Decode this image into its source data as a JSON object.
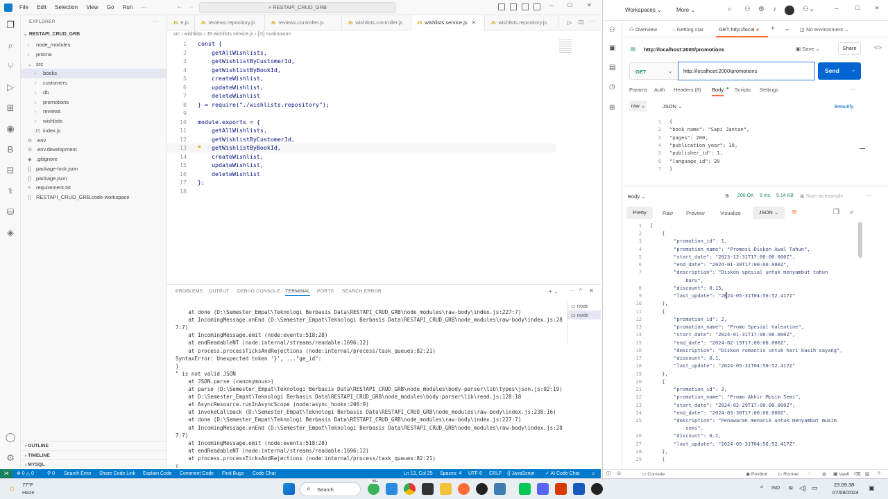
{
  "vscode": {
    "menu": [
      "File",
      "Edit",
      "Selection",
      "View",
      "Go",
      "Run"
    ],
    "menu_more": "···",
    "search_box": "RESTAPI_CRUD_GRB",
    "explorer_title": "EXPLORER",
    "explorer_more": "···",
    "root": "RESTAPI_CRUD_GRB",
    "tree": [
      {
        "label": "node_modules",
        "indent": 1,
        "arrow": "›"
      },
      {
        "label": "prisma",
        "indent": 1,
        "arrow": "›"
      },
      {
        "label": "src",
        "indent": 1,
        "arrow": "⌄"
      },
      {
        "label": "books",
        "indent": 2,
        "arrow": "›",
        "selected": true
      },
      {
        "label": "customers",
        "indent": 2,
        "arrow": "›"
      },
      {
        "label": "db",
        "indent": 2,
        "arrow": "›"
      },
      {
        "label": "promotions",
        "indent": 2,
        "arrow": "›"
      },
      {
        "label": "reviews",
        "indent": 2,
        "arrow": "›"
      },
      {
        "label": "wishlists",
        "indent": 2,
        "arrow": "›"
      },
      {
        "label": "index.js",
        "indent": 2,
        "arrow": "JS"
      },
      {
        "label": ".env",
        "indent": 1,
        "arrow": "⚙"
      },
      {
        "label": ".env.development",
        "indent": 1,
        "arrow": "⚙"
      },
      {
        "label": ".gitignore",
        "indent": 1,
        "arrow": "◆"
      },
      {
        "label": "package-lock.json",
        "indent": 1,
        "arrow": "{}"
      },
      {
        "label": "package.json",
        "indent": 1,
        "arrow": "{}"
      },
      {
        "label": "requirement.txt",
        "indent": 1,
        "arrow": "≡"
      },
      {
        "label": "RESTAPI_CRUD_GRB.code-workspace",
        "indent": 1,
        "arrow": "{}"
      }
    ],
    "sidebar_bottom": [
      "OUTLINE",
      "TIMELINE",
      "MYSQL"
    ],
    "tabs": [
      {
        "label": "e.js",
        "active": false
      },
      {
        "label": "reviews.repository.js",
        "active": false
      },
      {
        "label": "reviews.controller.js",
        "active": false
      },
      {
        "label": "wishlists.controller.js",
        "active": false
      },
      {
        "label": "wishlists.service.js",
        "active": true
      },
      {
        "label": "wishlists.repository.js",
        "active": false
      }
    ],
    "breadcrumb": "src › wishlists › JS wishlists.service.js › [∅] <unknown>",
    "code": [
      "const {",
      "    getAllWishlists,",
      "    getWishlistByCustomerId,",
      "    getWishlistByBookId,",
      "    createWishlist,",
      "    updateWishlist,",
      "    deleteWishlist",
      "} = require(\"./wishlists.repository\");",
      "",
      "module.exports = {",
      "    getAllWishlists,",
      "    getWishlistByCustomerId,",
      "    getWishlistByBookId,",
      "    createWishlist,",
      "    updateWishlist,",
      "    deleteWishlist",
      "};",
      ""
    ],
    "panel_tabs": [
      "PROBLEMS",
      "OUTPUT",
      "DEBUG CONSOLE",
      "TERMINAL",
      "PORTS",
      "SEARCH ERROR"
    ],
    "terminal": [
      "    at done (D:\\Semester_Empat\\Teknologi Berbasis Data\\RESTAPI_CRUD_GRB\\node_modules\\raw-body\\index.js:227:7)",
      "    at IncomingMessage.onEnd (D:\\Semester_Empat\\Teknologi Berbasis Data\\RESTAPI_CRUD_GRB\\node_modules\\raw-body\\index.js:28",
      "7:7)",
      "    at IncomingMessage.emit (node:events:518:28)",
      "    at endReadableNT (node:internal/streams/readable:1696:12)",
      "    at process.processTicksAndRejections (node:internal/process/task_queues:82:21)",
      "SyntaxError: Unexpected token '}', ...\"ge_id\":",
      "}",
      "\" is not valid JSON",
      "    at JSON.parse (<anonymous>)",
      "    at parse (D:\\Semester_Empat\\Teknologi Berbasis Data\\RESTAPI_CRUD_GRB\\node_modules\\body-parser\\lib\\types\\json.js:92:19)",
      "    at D:\\Semester_Empat\\Teknologi Berbasis Data\\RESTAPI_CRUD_GRB\\node_modules\\body-parser\\lib\\read.js:128:18",
      "    at AsyncResource.runInAsyncScope (node:async_hooks:206:9)",
      "    at invokeCallback (D:\\Semester_Empat\\Teknologi Berbasis Data\\RESTAPI_CRUD_GRB\\node_modules\\raw-body\\index.js:238:16)",
      "    at done (D:\\Semester_Empat\\Teknologi Berbasis Data\\RESTAPI_CRUD_GRB\\node_modules\\raw-body\\index.js:227:7)",
      "    at IncomingMessage.onEnd (D:\\Semester_Empat\\Teknologi Berbasis Data\\RESTAPI_CRUD_GRB\\node_modules\\raw-body\\index.js:28",
      "7:7)",
      "    at IncomingMessage.emit (node:events:518:28)",
      "    at endReadableNT (node:internal/streams/readable:1696:12)",
      "    at process.processTicksAndRejections (node:internal/process/task_queues:82:21)",
      "▯"
    ],
    "terminal_instances": [
      "node",
      "node"
    ],
    "status": {
      "errors": "⊗ 0 △ 0",
      "ports": "⚲ 0",
      "items": [
        "Search Error",
        "Share Code Link",
        "Explain Code",
        "Comment Code",
        "Find Bugs",
        "Code Chat"
      ],
      "position": "Ln 13, Col 25",
      "spaces": "Spaces: 4",
      "encoding": "UTF-8",
      "eol": "CRLF",
      "language": "{} JavaScript",
      "ai": "✓ AI Code Chat"
    }
  },
  "postman": {
    "workspaces": "Workspaces",
    "more": "More",
    "tabs": [
      "Overview",
      "Getting star",
      "GET http://local"
    ],
    "no_env": "No environment",
    "request_title": "http://localhost:2000/promotions",
    "save": "Save",
    "share": "Share",
    "method": "GET",
    "url": "http://localhost:2000/promotions",
    "send": "Send",
    "req_tabs": [
      "Params",
      "Auth",
      "Headers (8)",
      "Body",
      "Scripts",
      "Settings"
    ],
    "body_mode": "raw",
    "body_lang": "JSON",
    "beautify": "Beautify",
    "request_body": [
      "{",
      "\"book_name\": \"Sapi Jantan\",",
      "\"pages\": 200,",
      "\"publication_year\": 10,",
      "\"publisher_id\": 1,",
      "\"language_id\": 20",
      "}"
    ],
    "response_label": "Body",
    "status": "200 OK",
    "time": "8 ms",
    "size": "5.14 KB",
    "save_example": "Save as example",
    "resp_tabs": [
      "Pretty",
      "Raw",
      "Preview",
      "Visualize"
    ],
    "resp_lang": "JSON",
    "response": [
      "[",
      "    {",
      "        \"promotion_id\": 1,",
      "        \"promotion_name\": \"Promosi Diskon Awal Tahun\",",
      "        \"start_date\": \"2023-12-31T17:00:00.000Z\",",
      "        \"end_date\": \"2024-01-30T17:00:00.000Z\",",
      "        \"description\": \"Diskon spesial untuk menyambut tahun",
      "            baru\",",
      "        \"discount\": 0.15,",
      "        \"last_update\": \"2024-05-31T04:56:52.417Z\"",
      "    },",
      "    {",
      "        \"promotion_id\": 2,",
      "        \"promotion_name\": \"Promo Spesial Valentine\",",
      "        \"start_date\": \"2024-01-31T17:00:00.000Z\",",
      "        \"end_date\": \"2024-02-13T17:00:00.000Z\",",
      "        \"description\": \"Diskon romantis untuk hari kasih sayang\",",
      "        \"discount\": 0.1,",
      "        \"last_update\": \"2024-05-31T04:56:52.417Z\"",
      "    },",
      "    {",
      "        \"promotion_id\": 3,",
      "        \"promotion_name\": \"Promo Akhir Musim Semi\",",
      "        \"start_date\": \"2024-02-29T17:00:00.000Z\",",
      "        \"end_date\": \"2024-03-30T17:00:00.000Z\",",
      "        \"description\": \"Penawaran menarik untuk menyambut musim",
      "            semi\",",
      "        \"discount\": 0.2,",
      "        \"last_update\": \"2024-05-31T04:56:52.417Z\"",
      "    },",
      "    {"
    ],
    "response_line_numbers": [
      "1",
      "2",
      "3",
      "4",
      "5",
      "6",
      "7",
      "",
      "8",
      "9",
      "10",
      "11",
      "12",
      "13",
      "14",
      "15",
      "16",
      "17",
      "18",
      "19",
      "20",
      "21",
      "22",
      "23",
      "24",
      "25",
      "",
      "26",
      "27",
      "28",
      "29"
    ],
    "footer": [
      "Console",
      "Postbot",
      "Runner",
      "Start Proxy",
      "Cookies",
      "Vault",
      "Trash"
    ]
  },
  "taskbar": {
    "weather_temp": "77°F",
    "weather_desc": "Haze",
    "search": "Search",
    "badge": "99+",
    "lang": "IND",
    "time": "23.09.38",
    "date": "07/06/2024"
  },
  "colors": {
    "vscode_blue": "#007acc",
    "postman_send": "#0265d2",
    "postman_orange": "#ff6c37"
  }
}
